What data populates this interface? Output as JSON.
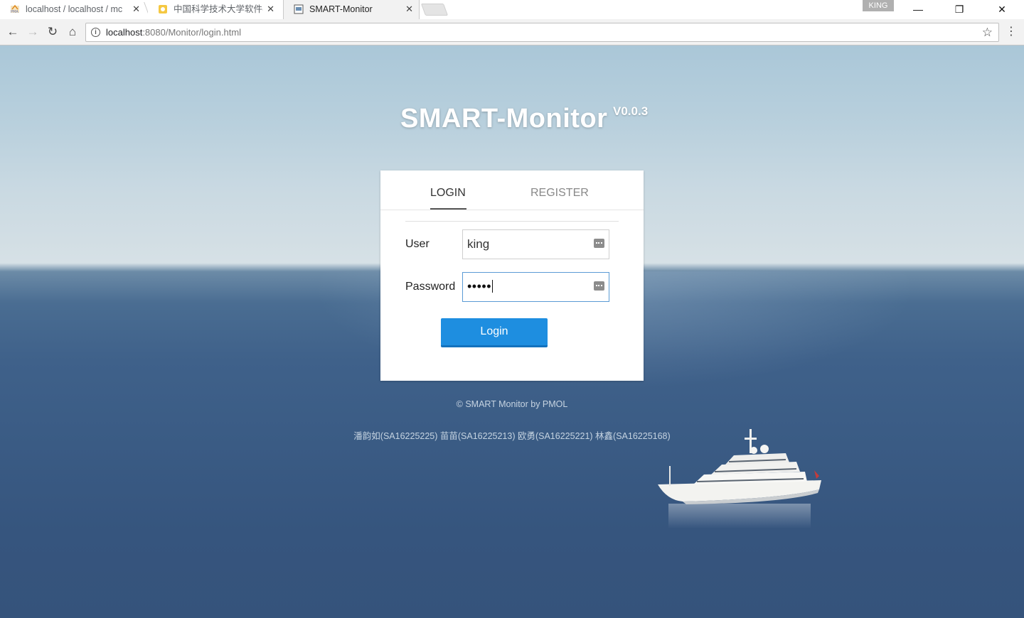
{
  "browser": {
    "tabs": [
      {
        "title": "localhost / localhost / mc",
        "favicon": "phpmyadmin-icon",
        "active": false
      },
      {
        "title": "中国科学技术大学软件学",
        "favicon": "ustc-icon",
        "active": false
      },
      {
        "title": "SMART-Monitor",
        "favicon": "page-icon",
        "active": true
      }
    ],
    "profile": "KING",
    "url_host": "localhost",
    "url_rest": ":8080/Monitor/login.html"
  },
  "app": {
    "title": "SMART-Monitor",
    "version": "V0.0.3"
  },
  "login": {
    "tabs": {
      "login": "LOGIN",
      "register": "REGISTER"
    },
    "user_label": "User",
    "user_value": "king",
    "password_label": "Password",
    "password_value": "•••••",
    "button": "Login"
  },
  "footer": {
    "copyright": "© SMART Monitor by PMOL",
    "authors": "潘韵如(SA16225225) 苗苗(SA16225213) 欧勇(SA16225221) 林鑫(SA16225168)"
  },
  "colors": {
    "accent": "#1e8ee0",
    "card_bg": "#ffffff"
  }
}
